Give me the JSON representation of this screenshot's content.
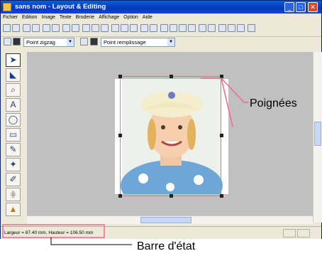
{
  "window": {
    "title": "sans nom - Layout & Editing"
  },
  "menu": [
    "Fichier",
    "Edition",
    "Image",
    "Texte",
    "Broderie",
    "Affichage",
    "Option",
    "Aide"
  ],
  "toolbar2": {
    "combo1": "Point zigzag",
    "combo2": "Point remplissage"
  },
  "status": {
    "text": "Largeur = 87.40 mm, Hauteur = 106.50 mm"
  },
  "annotations": {
    "handles": "Poignées",
    "statusbar": "Barre d'état"
  },
  "colors": {
    "title_bar": "#0a4bd0",
    "highlight": "#f06a8a",
    "canvas": "#c0c0c0"
  }
}
